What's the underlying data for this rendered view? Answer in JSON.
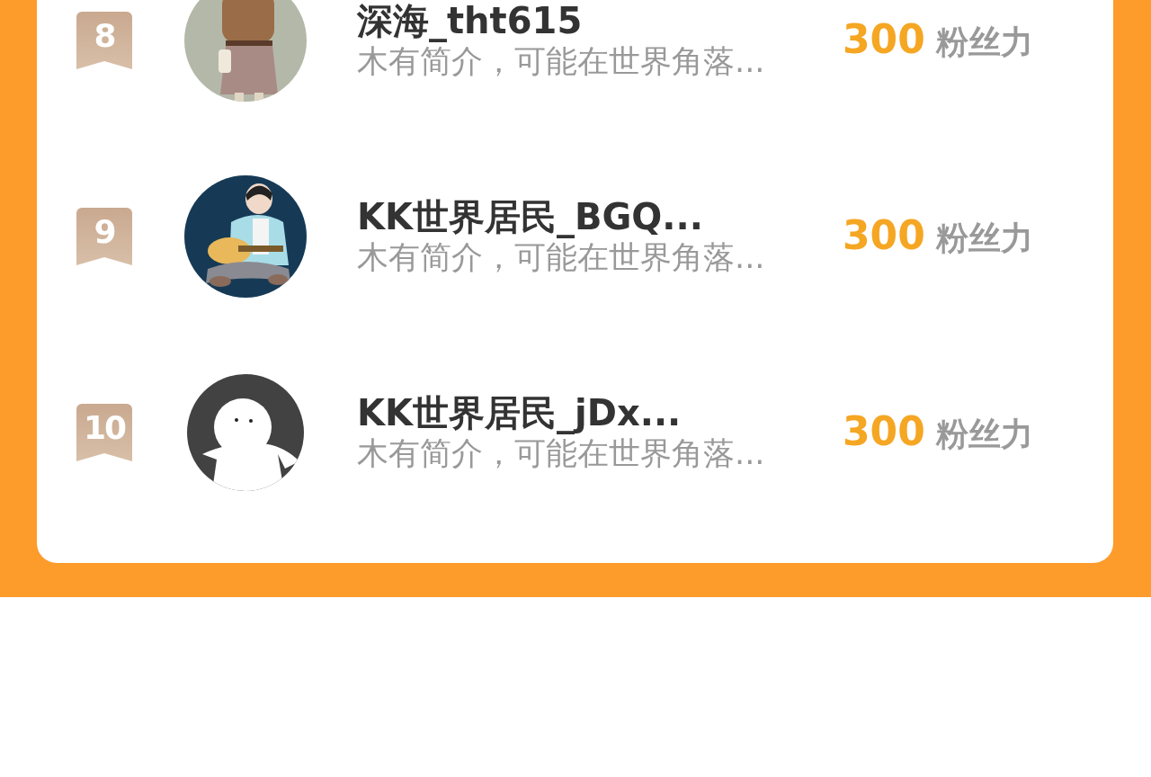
{
  "ranking": [
    {
      "rank": "8",
      "name": "深海_tht615",
      "bio": "木有简介，可能在世界角落...",
      "score": "300",
      "unit": "粉丝力"
    },
    {
      "rank": "9",
      "name": "KK世界居民_BGQ...",
      "bio": "木有简介，可能在世界角落...",
      "score": "300",
      "unit": "粉丝力"
    },
    {
      "rank": "10",
      "name": "KK世界居民_jDx...",
      "bio": "木有简介，可能在世界角落...",
      "score": "300",
      "unit": "粉丝力",
      "avatar": {
        "kind": "default"
      }
    }
  ]
}
